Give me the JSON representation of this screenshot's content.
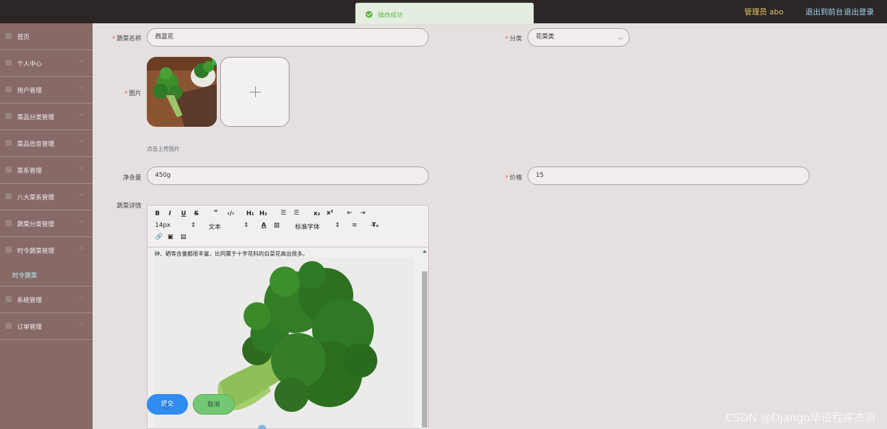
{
  "header": {
    "user_label": "管理员 abo",
    "front_link": "退出到前台",
    "logout_link": "退出登录"
  },
  "toast": {
    "message": "操作成功"
  },
  "sidebar": {
    "items": [
      {
        "label": "首页",
        "icon": "home-icon"
      },
      {
        "label": "个人中心",
        "icon": "user-icon"
      },
      {
        "label": "用户管理",
        "icon": "user-icon"
      },
      {
        "label": "菜品分类管理",
        "icon": "list-icon"
      },
      {
        "label": "菜品信息管理",
        "icon": "flag-icon"
      },
      {
        "label": "菜系管理",
        "icon": "grid-icon"
      },
      {
        "label": "八大菜系管理",
        "icon": "grid-icon"
      },
      {
        "label": "蔬菜分类管理",
        "icon": "folder-icon"
      },
      {
        "label": "时令蔬菜管理",
        "icon": "grid-icon"
      }
    ],
    "active_sub": "时令蔬菜",
    "items_after": [
      {
        "label": "系统管理",
        "icon": "gear-icon"
      },
      {
        "label": "订单管理",
        "icon": "doc-icon"
      }
    ]
  },
  "form": {
    "name_label": "蔬菜名称",
    "name_value": "西蓝花",
    "category_label": "分类",
    "category_value": "花菜类",
    "image_label": "图片",
    "upload_hint": "点击上传图片",
    "weight_label": "净含量",
    "weight_value": "450g",
    "price_label": "价格",
    "price_value": "15",
    "detail_label": "蔬菜详情"
  },
  "editor": {
    "font_size": "14px",
    "paragraph": "文本",
    "font_family": "标准字体",
    "content_line": "钟、硒等含量都很丰富，比同属于十字花科的白菜花高出很多。"
  },
  "buttons": {
    "submit": "提交",
    "cancel": "取消"
  },
  "watermark": "CSDN @Django毕设程序杰哥",
  "colors": {
    "topbar": "#2d2626",
    "sidebar": "#876a67",
    "primary": "#2f8cf0",
    "success": "#5fb544"
  }
}
